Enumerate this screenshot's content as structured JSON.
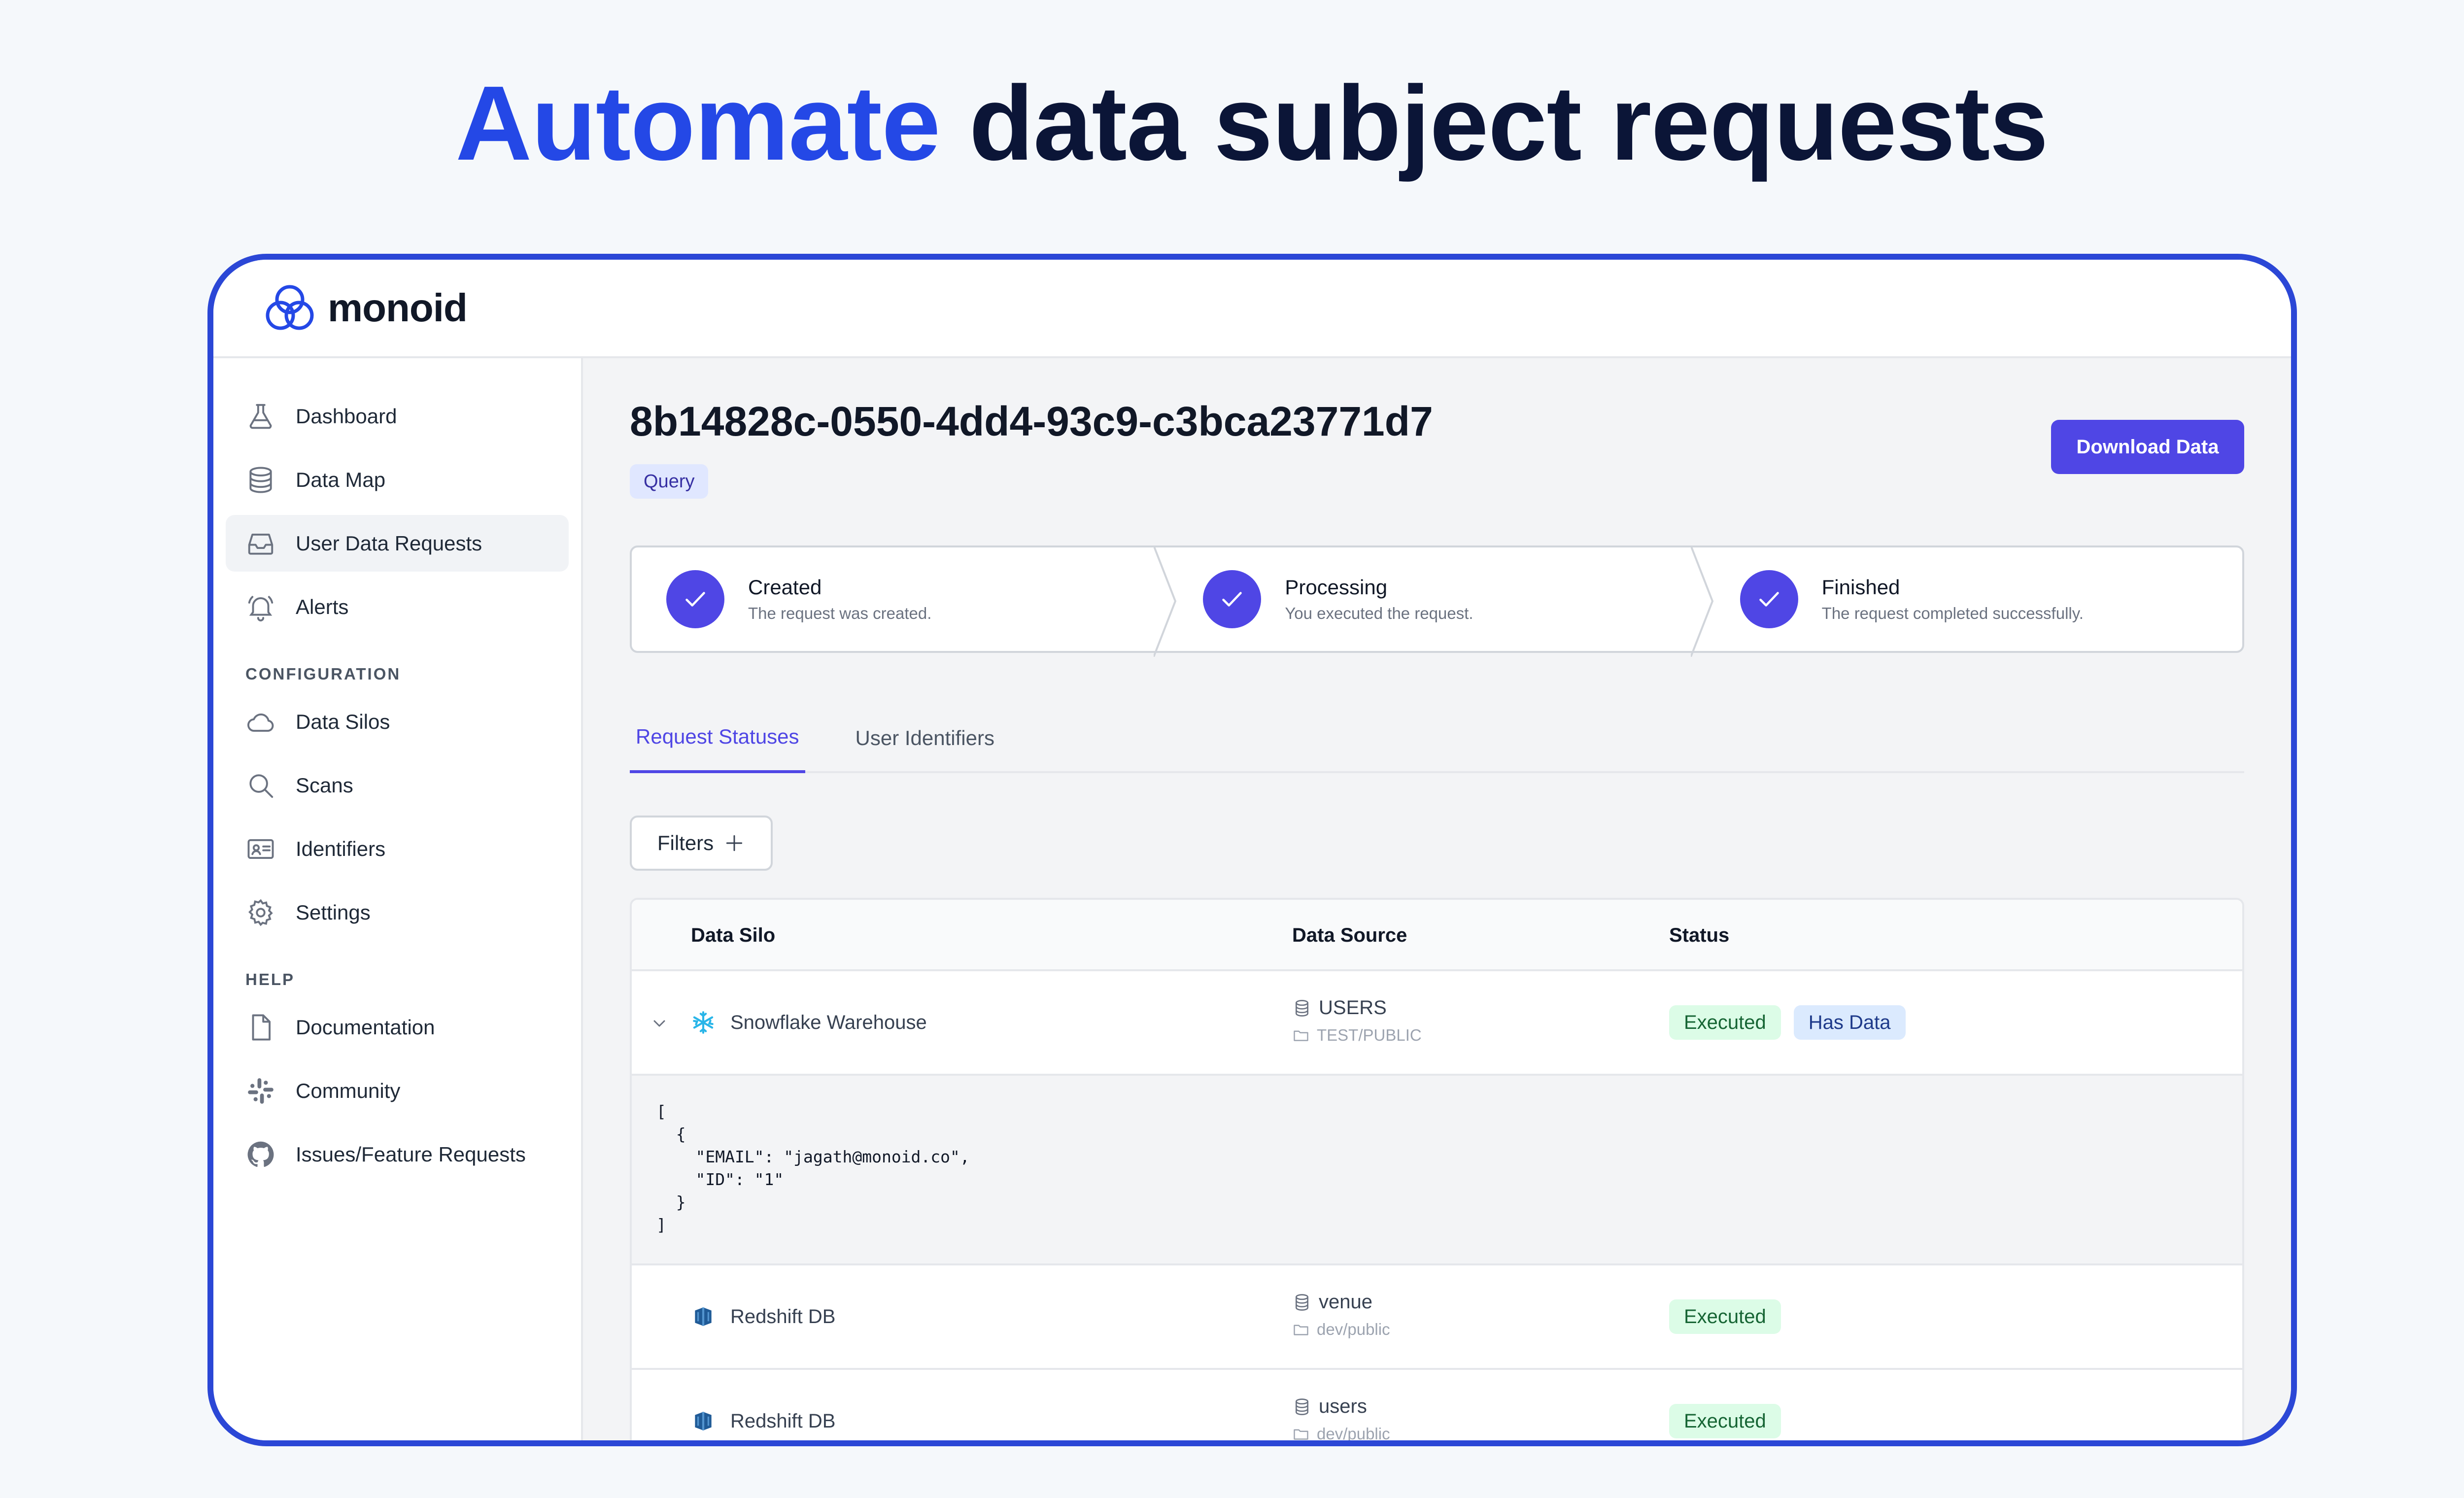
{
  "hero": {
    "accent": "Automate",
    "rest": "data subject requests"
  },
  "app": {
    "name": "monoid"
  },
  "sidebar": {
    "items": [
      {
        "label": "Dashboard",
        "icon": "flask-icon"
      },
      {
        "label": "Data Map",
        "icon": "database-icon"
      },
      {
        "label": "User Data Requests",
        "icon": "inbox-icon",
        "active": true
      },
      {
        "label": "Alerts",
        "icon": "bell-icon"
      }
    ],
    "configuration_label": "CONFIGURATION",
    "configuration": [
      {
        "label": "Data Silos",
        "icon": "cloud-icon"
      },
      {
        "label": "Scans",
        "icon": "search-icon"
      },
      {
        "label": "Identifiers",
        "icon": "id-card-icon"
      },
      {
        "label": "Settings",
        "icon": "gear-icon"
      }
    ],
    "help_label": "HELP",
    "help": [
      {
        "label": "Documentation",
        "icon": "document-icon"
      },
      {
        "label": "Community",
        "icon": "slack-icon"
      },
      {
        "label": "Issues/Feature Requests",
        "icon": "github-icon"
      }
    ]
  },
  "request": {
    "id": "8b14828c-0550-4dd4-93c9-c3bca23771d7",
    "type": "Query",
    "download_label": "Download Data"
  },
  "steps": [
    {
      "title": "Created",
      "desc": "The request was created."
    },
    {
      "title": "Processing",
      "desc": "You executed the request."
    },
    {
      "title": "Finished",
      "desc": "The request completed successfully."
    }
  ],
  "tabs": [
    {
      "label": "Request Statuses",
      "active": true
    },
    {
      "label": "User Identifiers"
    }
  ],
  "filters_label": "Filters",
  "table": {
    "headers": [
      "Data Silo",
      "Data Source",
      "Status"
    ],
    "rows": [
      {
        "silo": "Snowflake Warehouse",
        "source": "USERS",
        "path": "TEST/PUBLIC",
        "statuses": [
          "Executed",
          "Has Data"
        ],
        "expanded": true,
        "json": "[\n  {\n    \"EMAIL\": \"jagath@monoid.co\",\n    \"ID\": \"1\"\n  }\n]"
      },
      {
        "silo": "Redshift DB",
        "source": "venue",
        "path": "dev/public",
        "statuses": [
          "Executed"
        ]
      },
      {
        "silo": "Redshift DB",
        "source": "users",
        "path": "dev/public",
        "statuses": [
          "Executed"
        ]
      }
    ]
  },
  "colors": {
    "accent": "#2448e6",
    "primary": "#4f46e5",
    "frame": "#2b47d6",
    "executed_bg": "#dcfce7",
    "has_data_bg": "#dbeafe"
  }
}
